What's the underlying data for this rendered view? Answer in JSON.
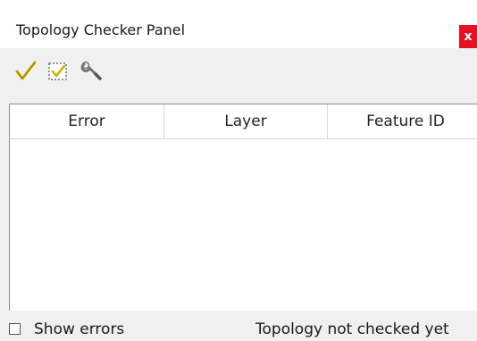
{
  "window": {
    "title": "Topology Checker Panel",
    "close_label": "x"
  },
  "toolbar": {
    "icons": [
      "validate-all-icon",
      "validate-extent-icon",
      "configure-rules-icon"
    ]
  },
  "table": {
    "columns": [
      "Error",
      "Layer",
      "Feature ID"
    ],
    "rows": []
  },
  "footer": {
    "show_errors_label": "Show errors",
    "show_errors_checked": false,
    "status": "Topology not checked yet"
  },
  "colors": {
    "close_button": "#e81123",
    "check_icon": "#d4b400"
  }
}
